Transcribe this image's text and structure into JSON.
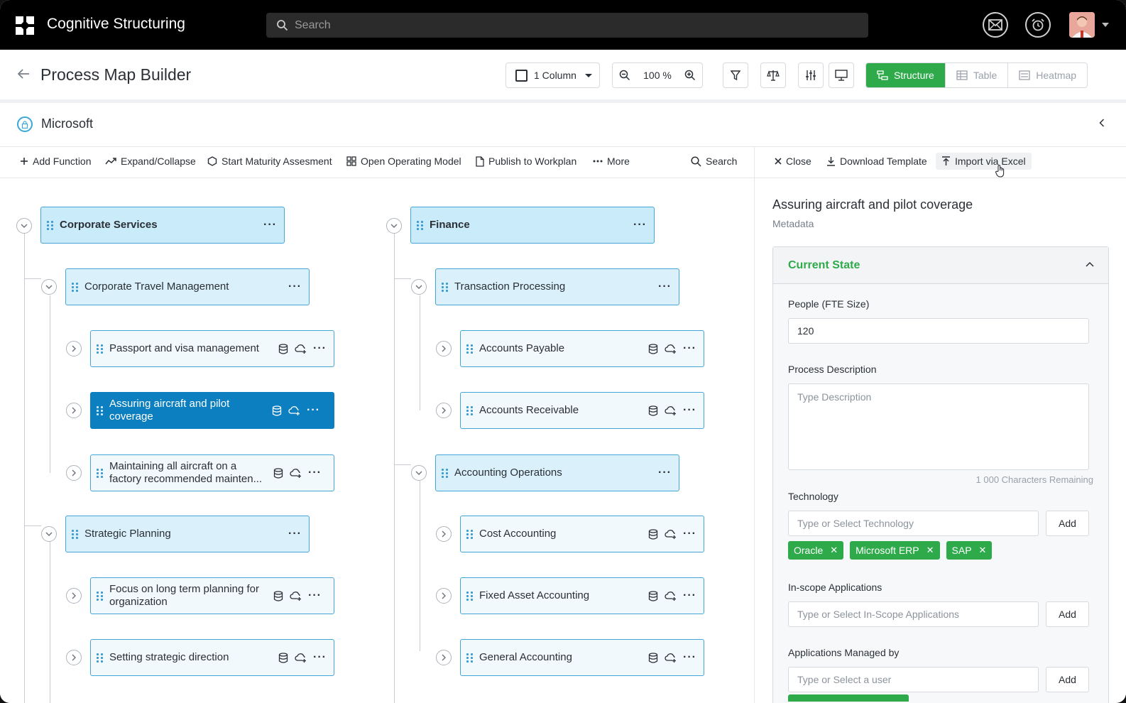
{
  "app": {
    "title": "Cognitive Structuring",
    "search_placeholder": "Search"
  },
  "page": {
    "title": "Process Map Builder",
    "column_select": "1 Column",
    "zoom": "100 %",
    "views": [
      {
        "label": "Structure",
        "active": true
      },
      {
        "label": "Table",
        "active": false
      },
      {
        "label": "Heatmap",
        "active": false
      }
    ]
  },
  "org": {
    "name": "Microsoft"
  },
  "toolbar": {
    "add_function": "Add Function",
    "expand_collapse": "Expand/Collapse",
    "start_maturity": "Start Maturity Assesment",
    "open_operating_model": "Open Operating Model",
    "publish": "Publish to Workplan",
    "more": "More",
    "search": "Search"
  },
  "panel_toolbar": {
    "close": "Close",
    "download_template": "Download Template",
    "import_excel": "Import via Excel"
  },
  "tree": {
    "col1": {
      "l1": "Corporate Services",
      "groups": [
        {
          "label": "Corporate Travel Management",
          "items": [
            "Passport and visa management",
            "Assuring aircraft and pilot coverage",
            "Maintaining all aircraft on a factory recommended mainten..."
          ]
        },
        {
          "label": "Strategic Planning",
          "items": [
            "Focus on long term planning for organization",
            "Setting strategic direction"
          ]
        }
      ]
    },
    "col2": {
      "l1": "Finance",
      "groups": [
        {
          "label": "Transaction Processing",
          "items": [
            "Accounts Payable",
            "Accounts Receivable"
          ]
        },
        {
          "label": "Accounting Operations",
          "items": [
            "Cost Accounting",
            "Fixed Asset Accounting",
            "General Accounting"
          ]
        }
      ]
    }
  },
  "panel": {
    "title": "Assuring aircraft and pilot coverage",
    "subtitle": "Metadata",
    "section": "Current State",
    "fte_label": "People (FTE Size)",
    "fte_value": "120",
    "desc_label": "Process Description",
    "desc_placeholder": "Type Description",
    "remaining": "1 000 Characters Remaining",
    "tech_label": "Technology",
    "tech_placeholder": "Type or Select Technology",
    "add": "Add",
    "tags": [
      "Oracle",
      "Microsoft ERP",
      "SAP"
    ],
    "apps_label": "In-scope Applications",
    "apps_placeholder": "Type or Select In-Scope Applications",
    "managed_label": "Applications Managed by",
    "managed_placeholder": "Type or Select a user"
  },
  "colors": {
    "accent_green": "#2eaa4b",
    "node_blue": "#0b7fc0",
    "node_border": "#43a6d6"
  }
}
